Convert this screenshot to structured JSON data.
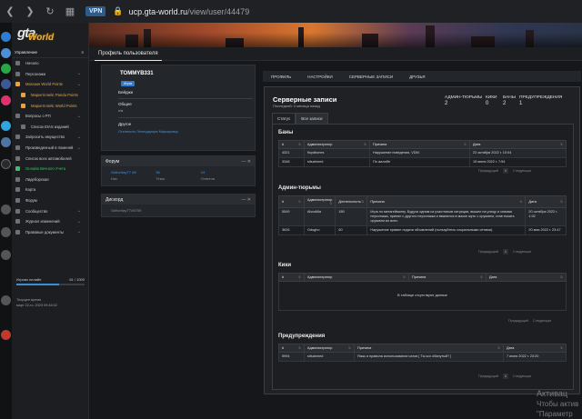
{
  "browser": {
    "vpn_label": "VPN",
    "url_host": "ucp.gta-world.ru",
    "url_path": "/view/user/44479"
  },
  "logo": {
    "gt": "gta",
    "world": "World"
  },
  "sidebar": {
    "section_label": "Управление",
    "items": [
      {
        "label": "Начало",
        "style": ""
      },
      {
        "label": "Персонажи",
        "style": "",
        "chevron": true
      },
      {
        "label": "Магазин World Points",
        "style": "orange",
        "chevron": true
      },
      {
        "label": "Маркетплейс Panda Points",
        "style": "orange",
        "sub": true
      },
      {
        "label": "Маркетплейс World Points",
        "style": "orange",
        "sub": true
      },
      {
        "label": "Вопросы о РП",
        "style": "",
        "chevron": true
      },
      {
        "label": "Список EIAS изданий",
        "style": "",
        "sub": true
      },
      {
        "label": "Запросить имущество",
        "style": "",
        "chevron": true
      },
      {
        "label": "Произведенный в поменяй",
        "style": "",
        "chevron": true
      },
      {
        "label": "Список всех автомобилей",
        "style": ""
      },
      {
        "label": "Онлайн Вечного Учета",
        "style": "green"
      },
      {
        "label": "Лидеборская",
        "style": ""
      },
      {
        "label": "Карта",
        "style": ""
      },
      {
        "label": "Форум",
        "style": ""
      },
      {
        "label": "Сообщество",
        "style": "",
        "chevron": true
      },
      {
        "label": "Журнал изменений",
        "style": "",
        "chevron": true
      },
      {
        "label": "Правовые документы",
        "style": "",
        "chevron": true
      }
    ],
    "online_label": "Игроки онлайн",
    "online_value": "61 / 1000",
    "online_fraction": 0.62,
    "server_time_label": "Текущее время",
    "server_time_value": "март 22-го, 2023 09:45:02"
  },
  "page_tab": "Профиль пользователя",
  "profile": {
    "username": "TOMMYB331",
    "badge": "Игрок",
    "badges_label": "Бейджи",
    "general_label": "Общее",
    "general_value": "n/a",
    "other_label": "Другое",
    "referral_link": "Отключить Легендарную Маркировку",
    "controls": "— ✕"
  },
  "forum": {
    "title": "Форум",
    "controls": "— ✕",
    "values": [
      "Gelfor/tayTT #6",
      "36",
      "24"
    ],
    "labels": [
      "Ник",
      "Темы",
      "Ответов"
    ]
  },
  "discord": {
    "title": "Дискорд",
    "controls": "— ✕",
    "value": "Gelfor/tayTT#5759"
  },
  "right_tabs": [
    "ПРОФИЛЬ",
    "НАСТРОЙКИ",
    "СЕРВЕРНЫЕ ЗАПИСИ",
    "ДРУЗЬЯ"
  ],
  "records": {
    "title": "Серверные записи",
    "subtitle": "Последний: 4 месяца назад",
    "stats": [
      {
        "label": "АДМИН-ТЮРЬМЫ",
        "value": "2"
      },
      {
        "label": "КИКИ",
        "value": "0"
      },
      {
        "label": "БАНЫ",
        "value": "2"
      },
      {
        "label": "ПРЕДУПРЕЖДЕНИЯ",
        "value": "1"
      }
    ],
    "sub_tabs": [
      "Статус",
      "Все записи"
    ],
    "bans": {
      "title": "Баны",
      "headers": [
        "#",
        "Администратор",
        "Причина",
        "Дата"
      ],
      "rows": [
        [
          "4321",
          "floydbones",
          "Нарушение поведения, VDM.",
          "22 октября 2022 г. 10:04"
        ],
        [
          "3348",
          "sitsahmed",
          "По жалобе",
          "15 июня 2022 г. 7:54"
        ]
      ],
      "prev": "Предыдущий",
      "page": "1",
      "next": "Следующая"
    },
    "jails": {
      "title": "Админ-тюрьмы",
      "headers": [
        "#",
        "Администратор",
        "Длительность",
        "Причина",
        "Дата"
      ],
      "rows": [
        [
          "5549",
          "AbouMia",
          "180",
          "Игра по метагеймингу. Будучи одним из участников ситуации, вышел на улицу и снимая персонажа, принял с другого персонажа и ввалился в маске жуть с оружием, став тыкать оружием во всех.",
          "20 октября 2022 г. 1:02"
        ],
        [
          "3626",
          "Odugho",
          "60",
          "Нарушение правил подачи объявлений (пользуйтесь социальными сетями).",
          "20 мая 2022 г. 23:47"
        ]
      ],
      "prev": "Предыдущий",
      "page": "1",
      "next": "Следующая"
    },
    "kicks": {
      "title": "Кики",
      "headers": [
        "#",
        "Администратор",
        "Причина",
        "Дата"
      ],
      "empty": "В таблице отсутствуют данные",
      "prev": "Предыдущий",
      "next": "Следующая"
    },
    "warnings": {
      "title": "Предупреждения",
      "headers": [
        "#",
        "Администратор",
        "Причина",
        "Дата"
      ],
      "rows": [
        [
          "5994",
          "sitsahmed",
          "Язык и правила использования чатов [ Ты ксо обанутый? ]",
          "7 июня 2022 г. 23:20"
        ]
      ],
      "prev": "Предыдущий",
      "page": "1",
      "next": "Следующая"
    }
  },
  "watermark": {
    "line1": "Активац",
    "line2": "Чтобы актив",
    "line3": "\"Параметр"
  }
}
